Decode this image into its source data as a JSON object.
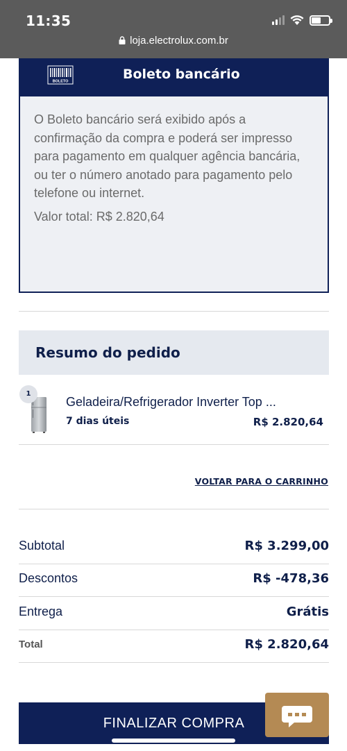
{
  "status_bar": {
    "time": "11:35"
  },
  "browser": {
    "url": "loja.electrolux.com.br"
  },
  "payment": {
    "logo_text": "BOLETO",
    "title": "Boleto bancário",
    "description": "O Boleto bancário será exibido após a confirmação da compra e poderá ser impresso para pagamento em qualquer agência bancária, ou ter o número anotado para pagamento pelo telefone ou internet.",
    "total": "Valor total: R$ 2.820,64"
  },
  "summary": {
    "title": "Resumo do pedido",
    "items": [
      {
        "quantity": "1",
        "name": "Geladeira/Refrigerador Inverter Top ...",
        "delivery": "7 dias úteis",
        "price": "R$ 2.820,64"
      }
    ],
    "back_link": "VOLTAR PARA O CARRINHO"
  },
  "totals": {
    "subtotal": {
      "label": "Subtotal",
      "value": "R$ 3.299,00"
    },
    "discounts": {
      "label": "Descontos",
      "value": "R$ -478,36"
    },
    "shipping": {
      "label": "Entrega",
      "value": "Grátis"
    },
    "total": {
      "label": "Total",
      "value": "R$ 2.820,64"
    }
  },
  "actions": {
    "finalize_label": "FINALIZAR COMPRA"
  },
  "colors": {
    "navy": "#0f2057",
    "chat": "#b48a54",
    "summary_bg": "#e5e9ef"
  }
}
